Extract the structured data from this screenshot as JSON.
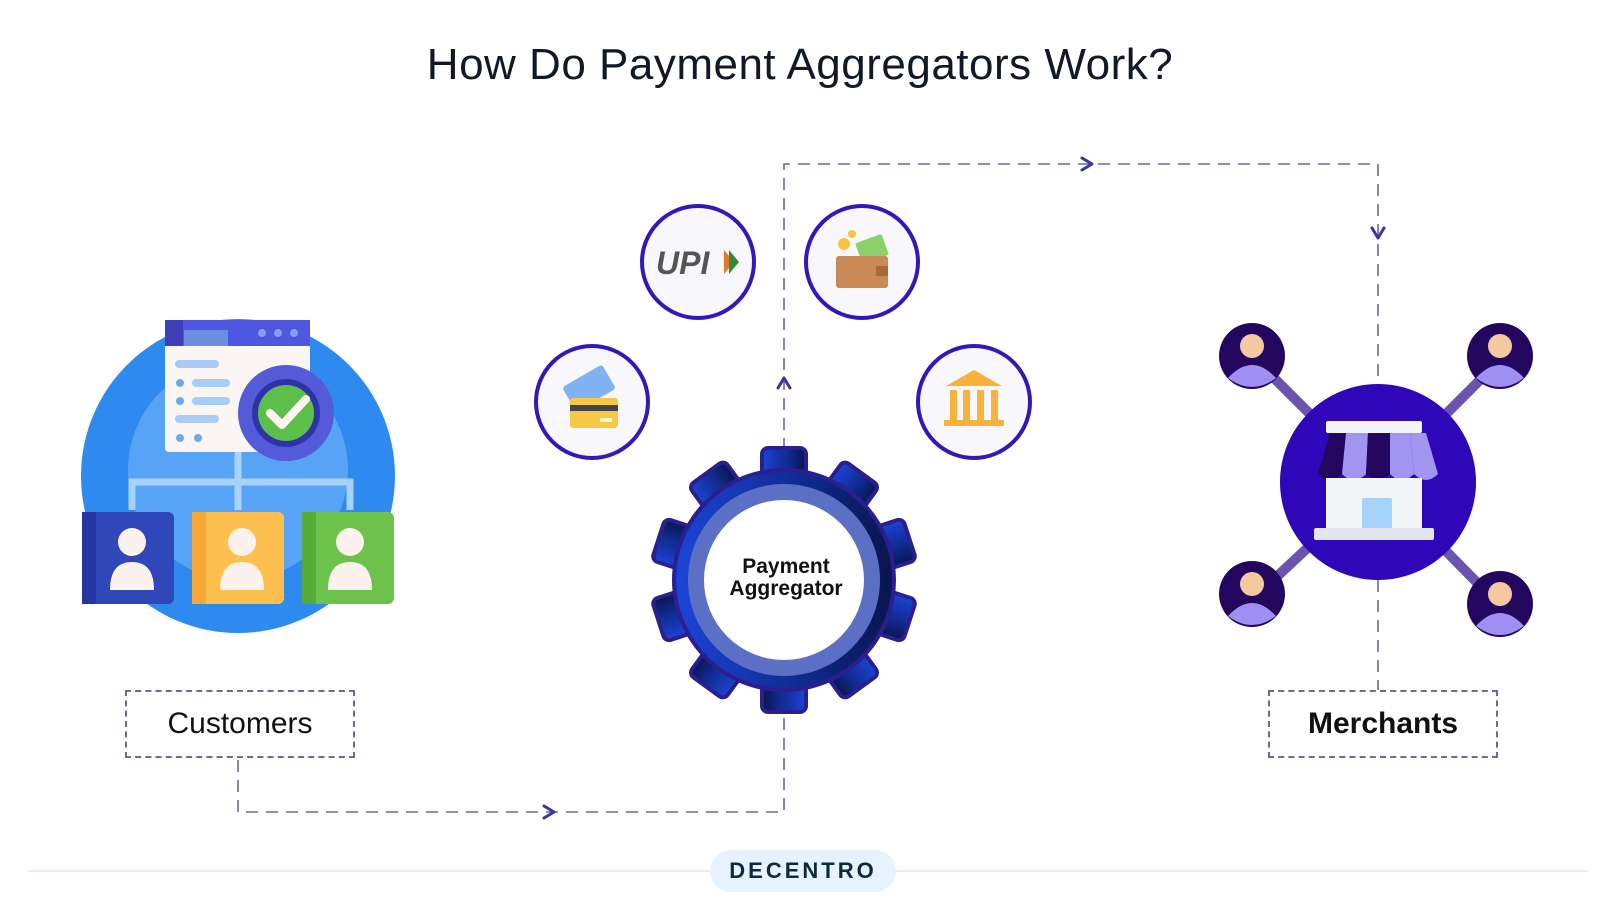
{
  "title": "How Do Payment Aggregators Work?",
  "nodes": {
    "customers": {
      "label": "Customers",
      "icon": "customers-org-icon"
    },
    "aggregator": {
      "line1": "Payment",
      "line2": "Aggregator",
      "icon": "gear-icon"
    },
    "merchants": {
      "label": "Merchants",
      "icon": "store-network-icon"
    }
  },
  "payment_methods": [
    {
      "name": "UPI",
      "icon": "upi-logo-icon",
      "text": "UPI"
    },
    {
      "name": "Wallet",
      "icon": "wallet-icon"
    },
    {
      "name": "Cards",
      "icon": "credit-card-icon"
    },
    {
      "name": "Net Banking",
      "icon": "bank-icon"
    }
  ],
  "flow": [
    {
      "from": "Customers",
      "to": "Payment Aggregator",
      "arrow": "right"
    },
    {
      "from": "Payment Aggregator",
      "to": "Payment Methods",
      "arrow": "up"
    },
    {
      "from": "Payment Aggregator",
      "to": "Merchants",
      "arrow": "right-then-down"
    }
  ],
  "brand": {
    "name": "DECENTRO"
  },
  "colors": {
    "primary": "#2f10b8",
    "dash": "#6b66a8",
    "arrow": "#3b35a0",
    "text": "#111827",
    "pill": "#e6f2fd"
  }
}
